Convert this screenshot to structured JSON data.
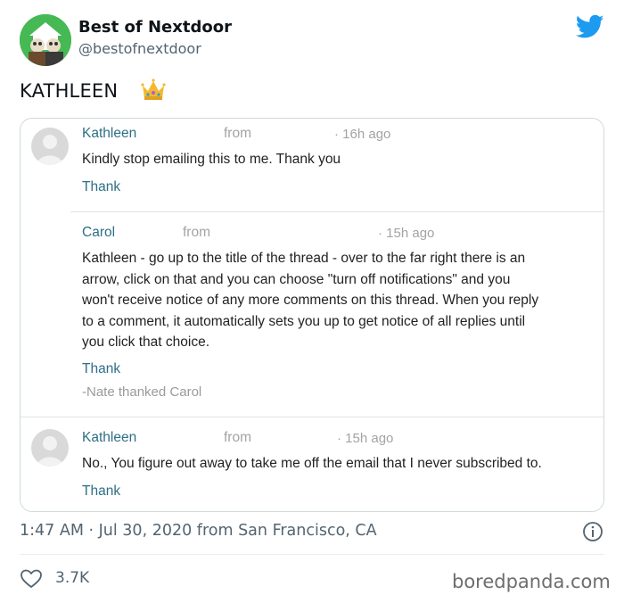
{
  "header": {
    "display_name": "Best of Nextdoor",
    "handle": "@bestofnextdoor",
    "avatar_icon": "muppets-avatar-icon",
    "bird_icon": "twitter-bird-icon",
    "brand_color": "#1d9bf0"
  },
  "tweet": {
    "text": "KATHLEEN",
    "emoji_icon": "crown-icon"
  },
  "thread": {
    "messages": [
      {
        "author": "Kathleen",
        "from_label": "from",
        "time": "· 16h ago",
        "body": "Kindly stop emailing this to me. Thank you",
        "thank_label": "Thank"
      },
      {
        "author": "Carol",
        "from_label": "from",
        "time": "· 15h ago",
        "body_lines": [
          "Kathleen - go up to the title of the thread - over to the far right there is an",
          "arrow, click on that and you can choose \"turn off notifications\" and you",
          "won't receive notice of any more comments on this thread. When you reply",
          "to a comment, it automatically sets you up to get notice of all replies until",
          "you click that choice."
        ],
        "thank_label": "Thank",
        "thanked_note": "-Nate thanked Carol"
      },
      {
        "author": "Kathleen",
        "from_label": "from",
        "time": "· 15h ago",
        "body": "No., You figure out away to take me off the email that I never subscribed to.",
        "thank_label": "Thank"
      }
    ]
  },
  "footer": {
    "timestamp": "1:47 AM · Jul 30, 2020 from San Francisco, CA",
    "likes": "3.7K",
    "watermark": "boredpanda.com"
  }
}
